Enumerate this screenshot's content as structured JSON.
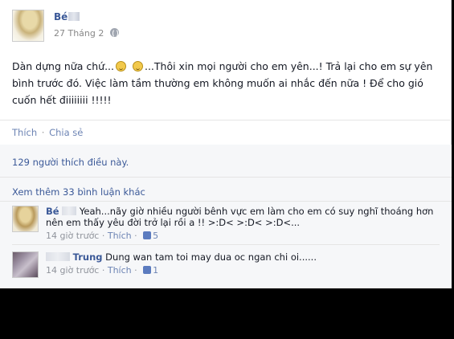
{
  "post": {
    "author": "Bé",
    "date": "27 Tháng 2",
    "text": "Dàn dựng nữa chứ...",
    "text_2": "...Thôi xin mọi người cho em yên...! Trả lại cho em sự yên bình trước đó. Việc làm tầm thường em không muốn ai nhắc đến nữa ! Để cho gió cuốn hết điiiiiiii !!!!!",
    "emoji_icon": "confused-emoji-icon"
  },
  "actions": {
    "like": "Thích",
    "sep": "·",
    "share": "Chia sẻ"
  },
  "feedback": {
    "likes": "129 người thích điều này.",
    "more_comments": "Xem thêm 33 bình luận khác"
  },
  "comments": [
    {
      "name": "Bé",
      "text": "Yeah...nãy giờ nhiều người bênh vực em làm cho em có suy nghĩ thoáng hơn nên em thấy yêu đời trở lại rồi a !! >:D< >:D< >:D<...",
      "time": "14 giờ trước",
      "like": "Thích",
      "like_count": "5"
    },
    {
      "name": "Trung",
      "text": "Dung wan tam toi may dua oc ngan chi oi......",
      "time": "14 giờ trước",
      "like": "Thích",
      "like_count": "1"
    }
  ],
  "colors": {
    "link": "#3b5998",
    "muted": "#90949c",
    "feedback_bg": "#f6f7f9"
  }
}
